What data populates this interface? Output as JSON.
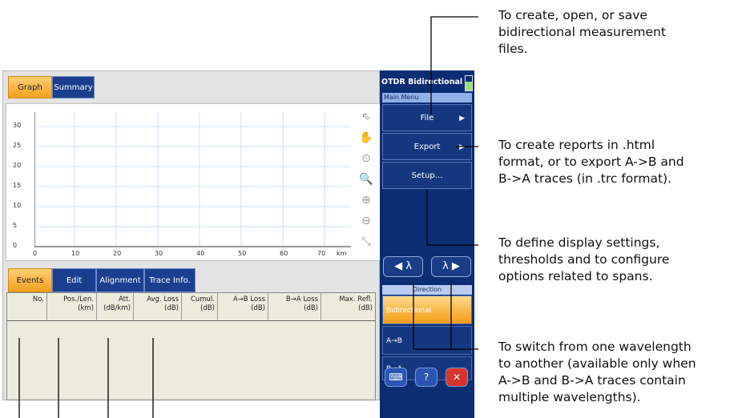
{
  "left_tabs": {
    "graph": "Graph",
    "summary": "Summary"
  },
  "graph": {
    "y_ticks": [
      "30",
      "25",
      "20",
      "15",
      "10",
      "5",
      "0"
    ],
    "x_ticks": [
      "0",
      "10",
      "20",
      "30",
      "40",
      "50",
      "60",
      "70",
      "km"
    ]
  },
  "bottom_tabs": {
    "events": "Events",
    "edit": "Edit",
    "alignment": "Alignment",
    "trace_info": "Trace Info."
  },
  "table": {
    "columns": [
      {
        "line1": "No.",
        "line2": ""
      },
      {
        "line1": "Pos./Len.",
        "line2": "(km)"
      },
      {
        "line1": "Att.",
        "line2": "(dB/km)"
      },
      {
        "line1": "Avg. Loss",
        "line2": "(dB)"
      },
      {
        "line1": "Cumul.",
        "line2": "(dB)"
      },
      {
        "line1": "A→B Loss",
        "line2": "(dB)"
      },
      {
        "line1": "B→A Loss",
        "line2": "(dB)"
      },
      {
        "line1": "Max. Refl.",
        "line2": "(dB)"
      }
    ]
  },
  "right_panel": {
    "title": "OTDR Bidirectional",
    "main_menu": "Main Menu",
    "file": "File",
    "export": "Export",
    "setup": "Setup...",
    "direction_label": "Direction",
    "bidirectional": "Bidirectional",
    "a_to_b": "A→B",
    "b_to_a": "B→A"
  },
  "callouts": {
    "file": "To create, open, or save\nbidirectional measurement\nfiles.",
    "export": "To create reports in .html\nformat, or to export A->B and\nB->A traces (in .trc format).",
    "setup": "To define display settings,\nthresholds and to configure\noptions related to spans.",
    "wavelength": "To switch from one wavelength\nto another (available only when\nA->B and B->A traces contain\nmultiple wavelengths)."
  },
  "icons": [
    "left-wavelength-arrow-icon",
    "right-wavelength-arrow-icon",
    "keyboard-icon",
    "help-icon",
    "close-icon",
    "pointer-icon",
    "hand-icon",
    "zoom-icon"
  ]
}
